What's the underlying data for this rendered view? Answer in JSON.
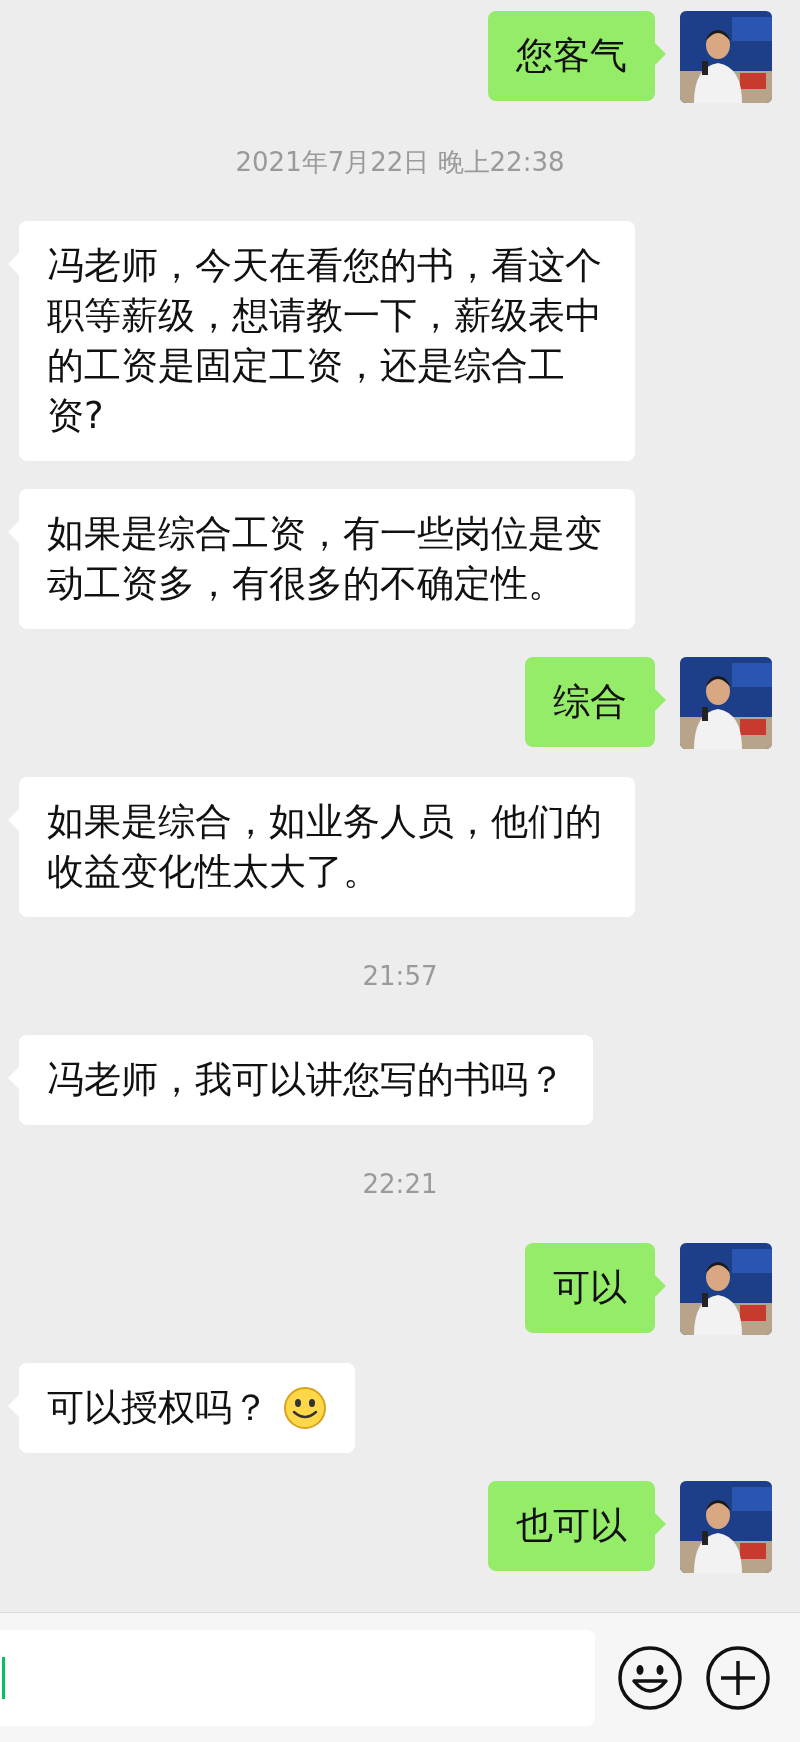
{
  "messages": [
    {
      "kind": "text",
      "sent": true,
      "text": "您客气"
    },
    {
      "kind": "timestamp",
      "text": "2021年7月22日 晚上22:38"
    },
    {
      "kind": "text",
      "sent": false,
      "text": "冯老师，今天在看您的书，看这个职等薪级，想请教一下，薪级表中的工资是固定工资，还是综合工资?"
    },
    {
      "kind": "text",
      "sent": false,
      "text": "如果是综合工资，有一些岗位是变动工资多，有很多的不确定性。"
    },
    {
      "kind": "text",
      "sent": true,
      "text": "综合"
    },
    {
      "kind": "text",
      "sent": false,
      "text": "如果是综合，如业务人员，他们的收益变化性太大了。"
    },
    {
      "kind": "timestamp",
      "text": "21:57"
    },
    {
      "kind": "text",
      "sent": false,
      "text": "冯老师，我可以讲您写的书吗？"
    },
    {
      "kind": "timestamp",
      "text": "22:21"
    },
    {
      "kind": "text",
      "sent": true,
      "text": "可以"
    },
    {
      "kind": "text",
      "sent": false,
      "text": "可以授权吗？",
      "emoji": true
    },
    {
      "kind": "text",
      "sent": true,
      "text": "也可以"
    }
  ],
  "input_bar": {
    "cursor": true
  }
}
